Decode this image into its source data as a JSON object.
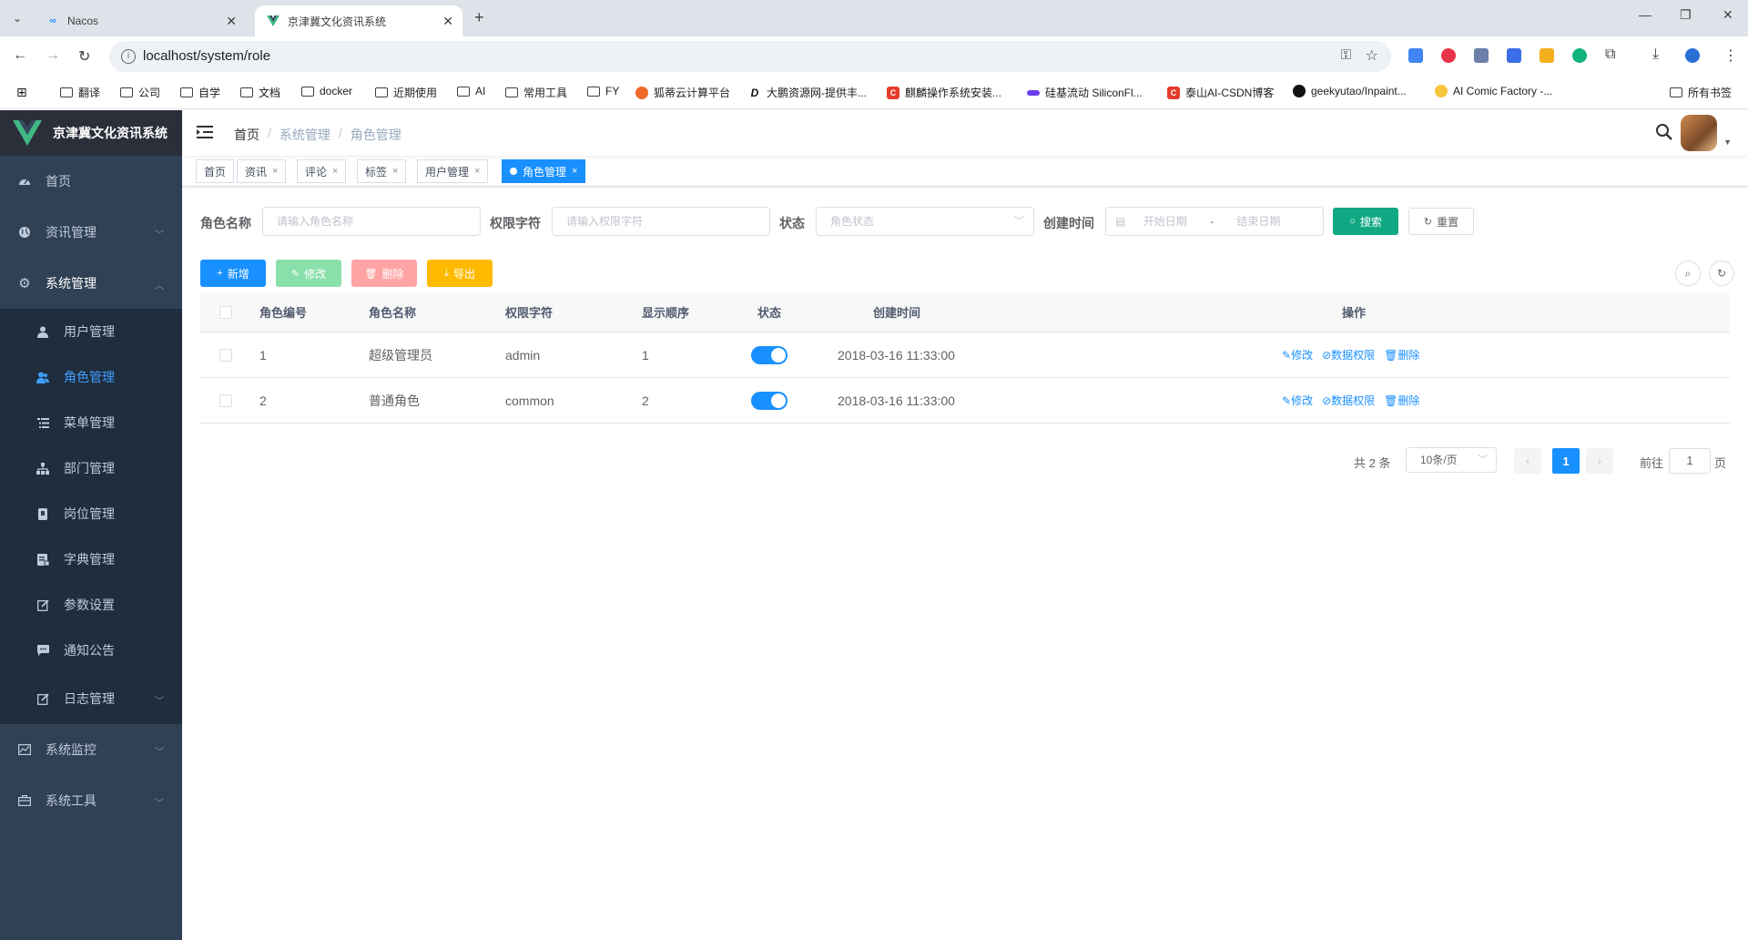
{
  "browser": {
    "tabs": [
      {
        "title": "Nacos",
        "active": false
      },
      {
        "title": "京津冀文化资讯系统",
        "active": true
      }
    ],
    "url": "localhost/system/role",
    "bookmarks": [
      "翻译",
      "公司",
      "自学",
      "文档",
      "docker",
      "近期使用",
      "AI",
      "常用工具",
      "FY",
      "狐蒂云计算平台",
      "大鹏资源网-提供丰...",
      "麒麟操作系统安装...",
      "硅基流动 SiliconFl...",
      "泰山AI-CSDN博客",
      "geekyutao/Inpaint...",
      "AI Comic Factory -..."
    ],
    "all_bookmarks": "所有书签"
  },
  "sidebar": {
    "title": "京津冀文化资讯系统",
    "items": [
      {
        "label": "首页",
        "icon": "dashboard-icon"
      },
      {
        "label": "资讯管理",
        "icon": "globe-icon"
      },
      {
        "label": "系统管理",
        "icon": "gear-icon"
      },
      {
        "label": "用户管理",
        "icon": "user-icon"
      },
      {
        "label": "角色管理",
        "icon": "peoples-icon"
      },
      {
        "label": "菜单管理",
        "icon": "tree-table-icon"
      },
      {
        "label": "部门管理",
        "icon": "tree-icon"
      },
      {
        "label": "岗位管理",
        "icon": "post-icon"
      },
      {
        "label": "字典管理",
        "icon": "dict-icon"
      },
      {
        "label": "参数设置",
        "icon": "edit-icon"
      },
      {
        "label": "通知公告",
        "icon": "message-icon"
      },
      {
        "label": "日志管理",
        "icon": "log-icon"
      },
      {
        "label": "系统监控",
        "icon": "monitor-icon"
      },
      {
        "label": "系统工具",
        "icon": "tool-icon"
      }
    ]
  },
  "navbar": {
    "breadcrumb": [
      "首页",
      "系统管理",
      "角色管理"
    ]
  },
  "tags": [
    "首页",
    "资讯",
    "评论",
    "标签",
    "用户管理",
    "角色管理"
  ],
  "search_form": {
    "role_name_label": "角色名称",
    "role_name_placeholder": "请输入角色名称",
    "role_key_label": "权限字符",
    "role_key_placeholder": "请输入权限字符",
    "status_label": "状态",
    "status_placeholder": "角色状态",
    "created_label": "创建时间",
    "start_placeholder": "开始日期",
    "range_sep": "-",
    "end_placeholder": "结束日期",
    "search_btn": "搜索",
    "reset_btn": "重置"
  },
  "actions": {
    "add": "新增",
    "edit": "修改",
    "delete": "删除",
    "export": "导出"
  },
  "table": {
    "headers": [
      "角色编号",
      "角色名称",
      "权限字符",
      "显示顺序",
      "状态",
      "创建时间",
      "操作"
    ],
    "rows": [
      {
        "id": "1",
        "name": "超级管理员",
        "key": "admin",
        "sort": "1",
        "status": true,
        "created": "2018-03-16 11:33:00"
      },
      {
        "id": "2",
        "name": "普通角色",
        "key": "common",
        "sort": "2",
        "status": true,
        "created": "2018-03-16 11:33:00"
      }
    ],
    "ops": [
      "修改",
      "数据权限",
      "删除"
    ]
  },
  "pagination": {
    "total": "共 2 条",
    "page_size": "10条/页",
    "current": "1",
    "goto_label": "前往",
    "goto_value": "1",
    "page_unit": "页"
  },
  "colors": {
    "primary": "#1890ff",
    "sidebar_bg": "#304156",
    "success": "#13ce66",
    "danger": "#ff4949",
    "warning": "#ffba00",
    "teal": "#11a983"
  }
}
